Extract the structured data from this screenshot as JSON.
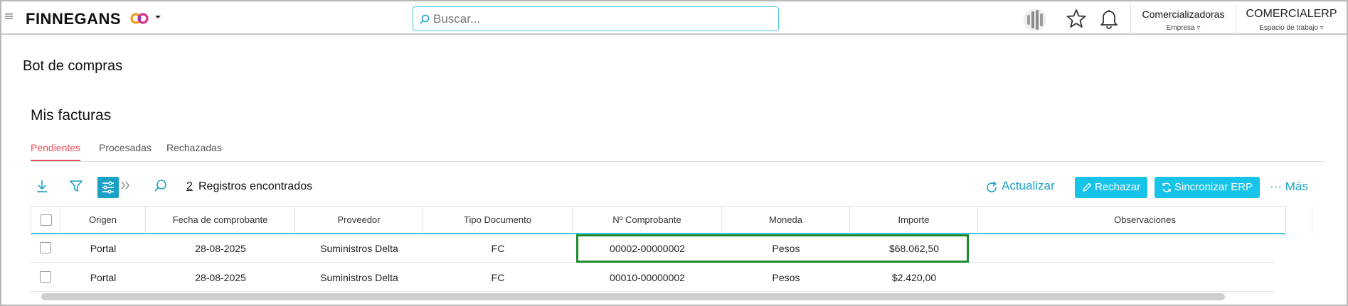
{
  "topbar": {
    "brand": "FINNEGANS",
    "search_placeholder": "Buscar...",
    "company": {
      "title": "Comercializadoras",
      "subtitle": "Empresa"
    },
    "workspace": {
      "title": "COMERCIALERP",
      "subtitle": "Espacio de trabajo"
    }
  },
  "page": {
    "title": "Bot de compras"
  },
  "section": {
    "title": "Mis facturas"
  },
  "tabs": [
    {
      "label": "Pendientes",
      "active": true
    },
    {
      "label": "Procesadas",
      "active": false
    },
    {
      "label": "Rechazadas",
      "active": false
    }
  ],
  "toolbar": {
    "count": "2",
    "count_label": "Registros encontrados",
    "refresh_label": "Actualizar",
    "reject_label": "Rechazar",
    "sync_label": "Sincronizar ERP",
    "more_label": "··· Más"
  },
  "table": {
    "columns": [
      "Origen",
      "Fecha de comprobante",
      "Proveedor",
      "Tipo Documento",
      "Nº Comprobante",
      "Moneda",
      "Importe",
      "Observaciones"
    ],
    "rows": [
      {
        "origen": "Portal",
        "fecha": "28-08-2025",
        "proveedor": "Suministros Delta",
        "tipo": "FC",
        "numero": "00002-00000002",
        "moneda": "Pesos",
        "importe": "$68.062,50",
        "observaciones": ""
      },
      {
        "origen": "Portal",
        "fecha": "28-08-2025",
        "proveedor": "Suministros Delta",
        "tipo": "FC",
        "numero": "00010-00000002",
        "moneda": "Pesos",
        "importe": "$2.420,00",
        "observaciones": ""
      }
    ]
  },
  "colors": {
    "accent": "#1aa1c6",
    "button": "#18c3e9",
    "active_tab": "#e8505b",
    "highlight": "#1f8a2e"
  }
}
